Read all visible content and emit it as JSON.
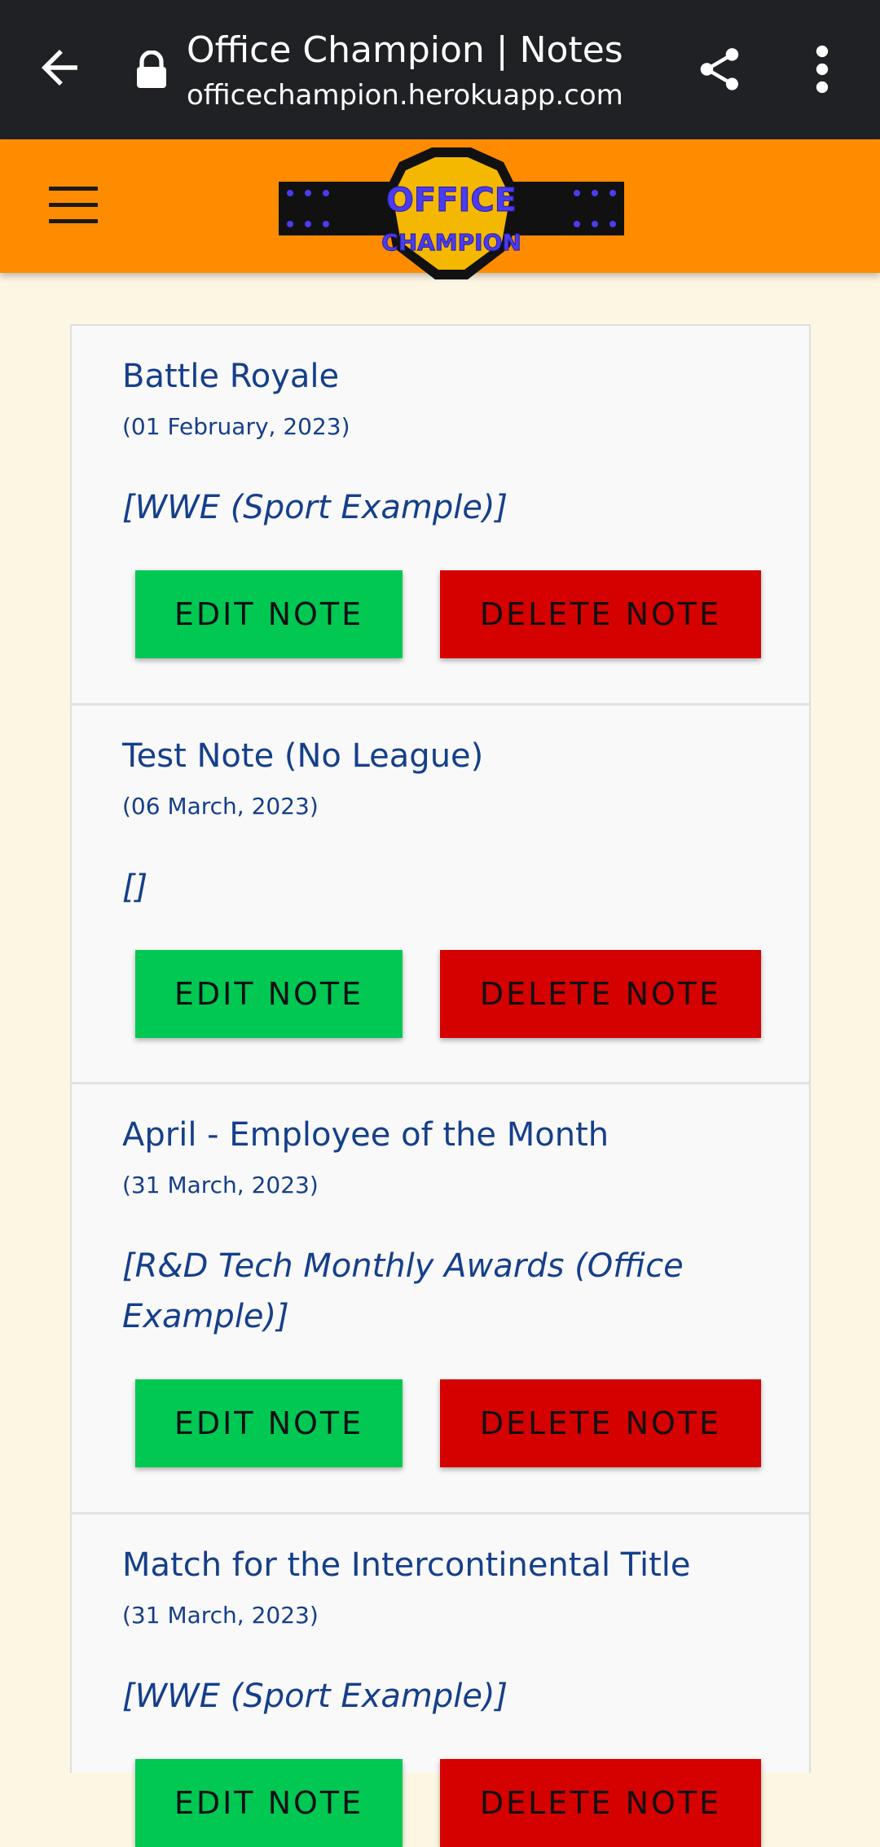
{
  "browser": {
    "title": "Office Champion | Notes",
    "url": "officechampion.herokuapp.com",
    "back_icon": "arrow-back-icon",
    "lock_icon": "lock-icon",
    "share_icon": "share-icon",
    "more_icon": "more-vert-icon"
  },
  "header": {
    "menu_icon": "hamburger-menu-icon",
    "logo_text_top": "OFFICE",
    "logo_text_bottom": "CHAMPION",
    "background_color": "#ff8c00"
  },
  "notes": [
    {
      "title": "Battle Royale",
      "date": "(01 February, 2023)",
      "league": "[WWE (Sport Example)]",
      "edit_label": "EDIT NOTE",
      "delete_label": "DELETE NOTE"
    },
    {
      "title": "Test Note (No League)",
      "date": "(06 March, 2023)",
      "league": "[]",
      "edit_label": "EDIT NOTE",
      "delete_label": "DELETE NOTE"
    },
    {
      "title": "April - Employee of the Month",
      "date": "(31 March, 2023)",
      "league": "[R&D Tech Monthly Awards (Office Example)]",
      "edit_label": "EDIT NOTE",
      "delete_label": "DELETE NOTE"
    },
    {
      "title": "Match for the Intercontinental Title",
      "date": "(31 March, 2023)",
      "league": "[WWE (Sport Example)]",
      "edit_label": "EDIT NOTE",
      "delete_label": "DELETE NOTE"
    }
  ],
  "colors": {
    "page_background": "#fdf6e2",
    "edit_button": "#00c853",
    "delete_button": "#d50000",
    "text_blue": "#153f8a"
  }
}
